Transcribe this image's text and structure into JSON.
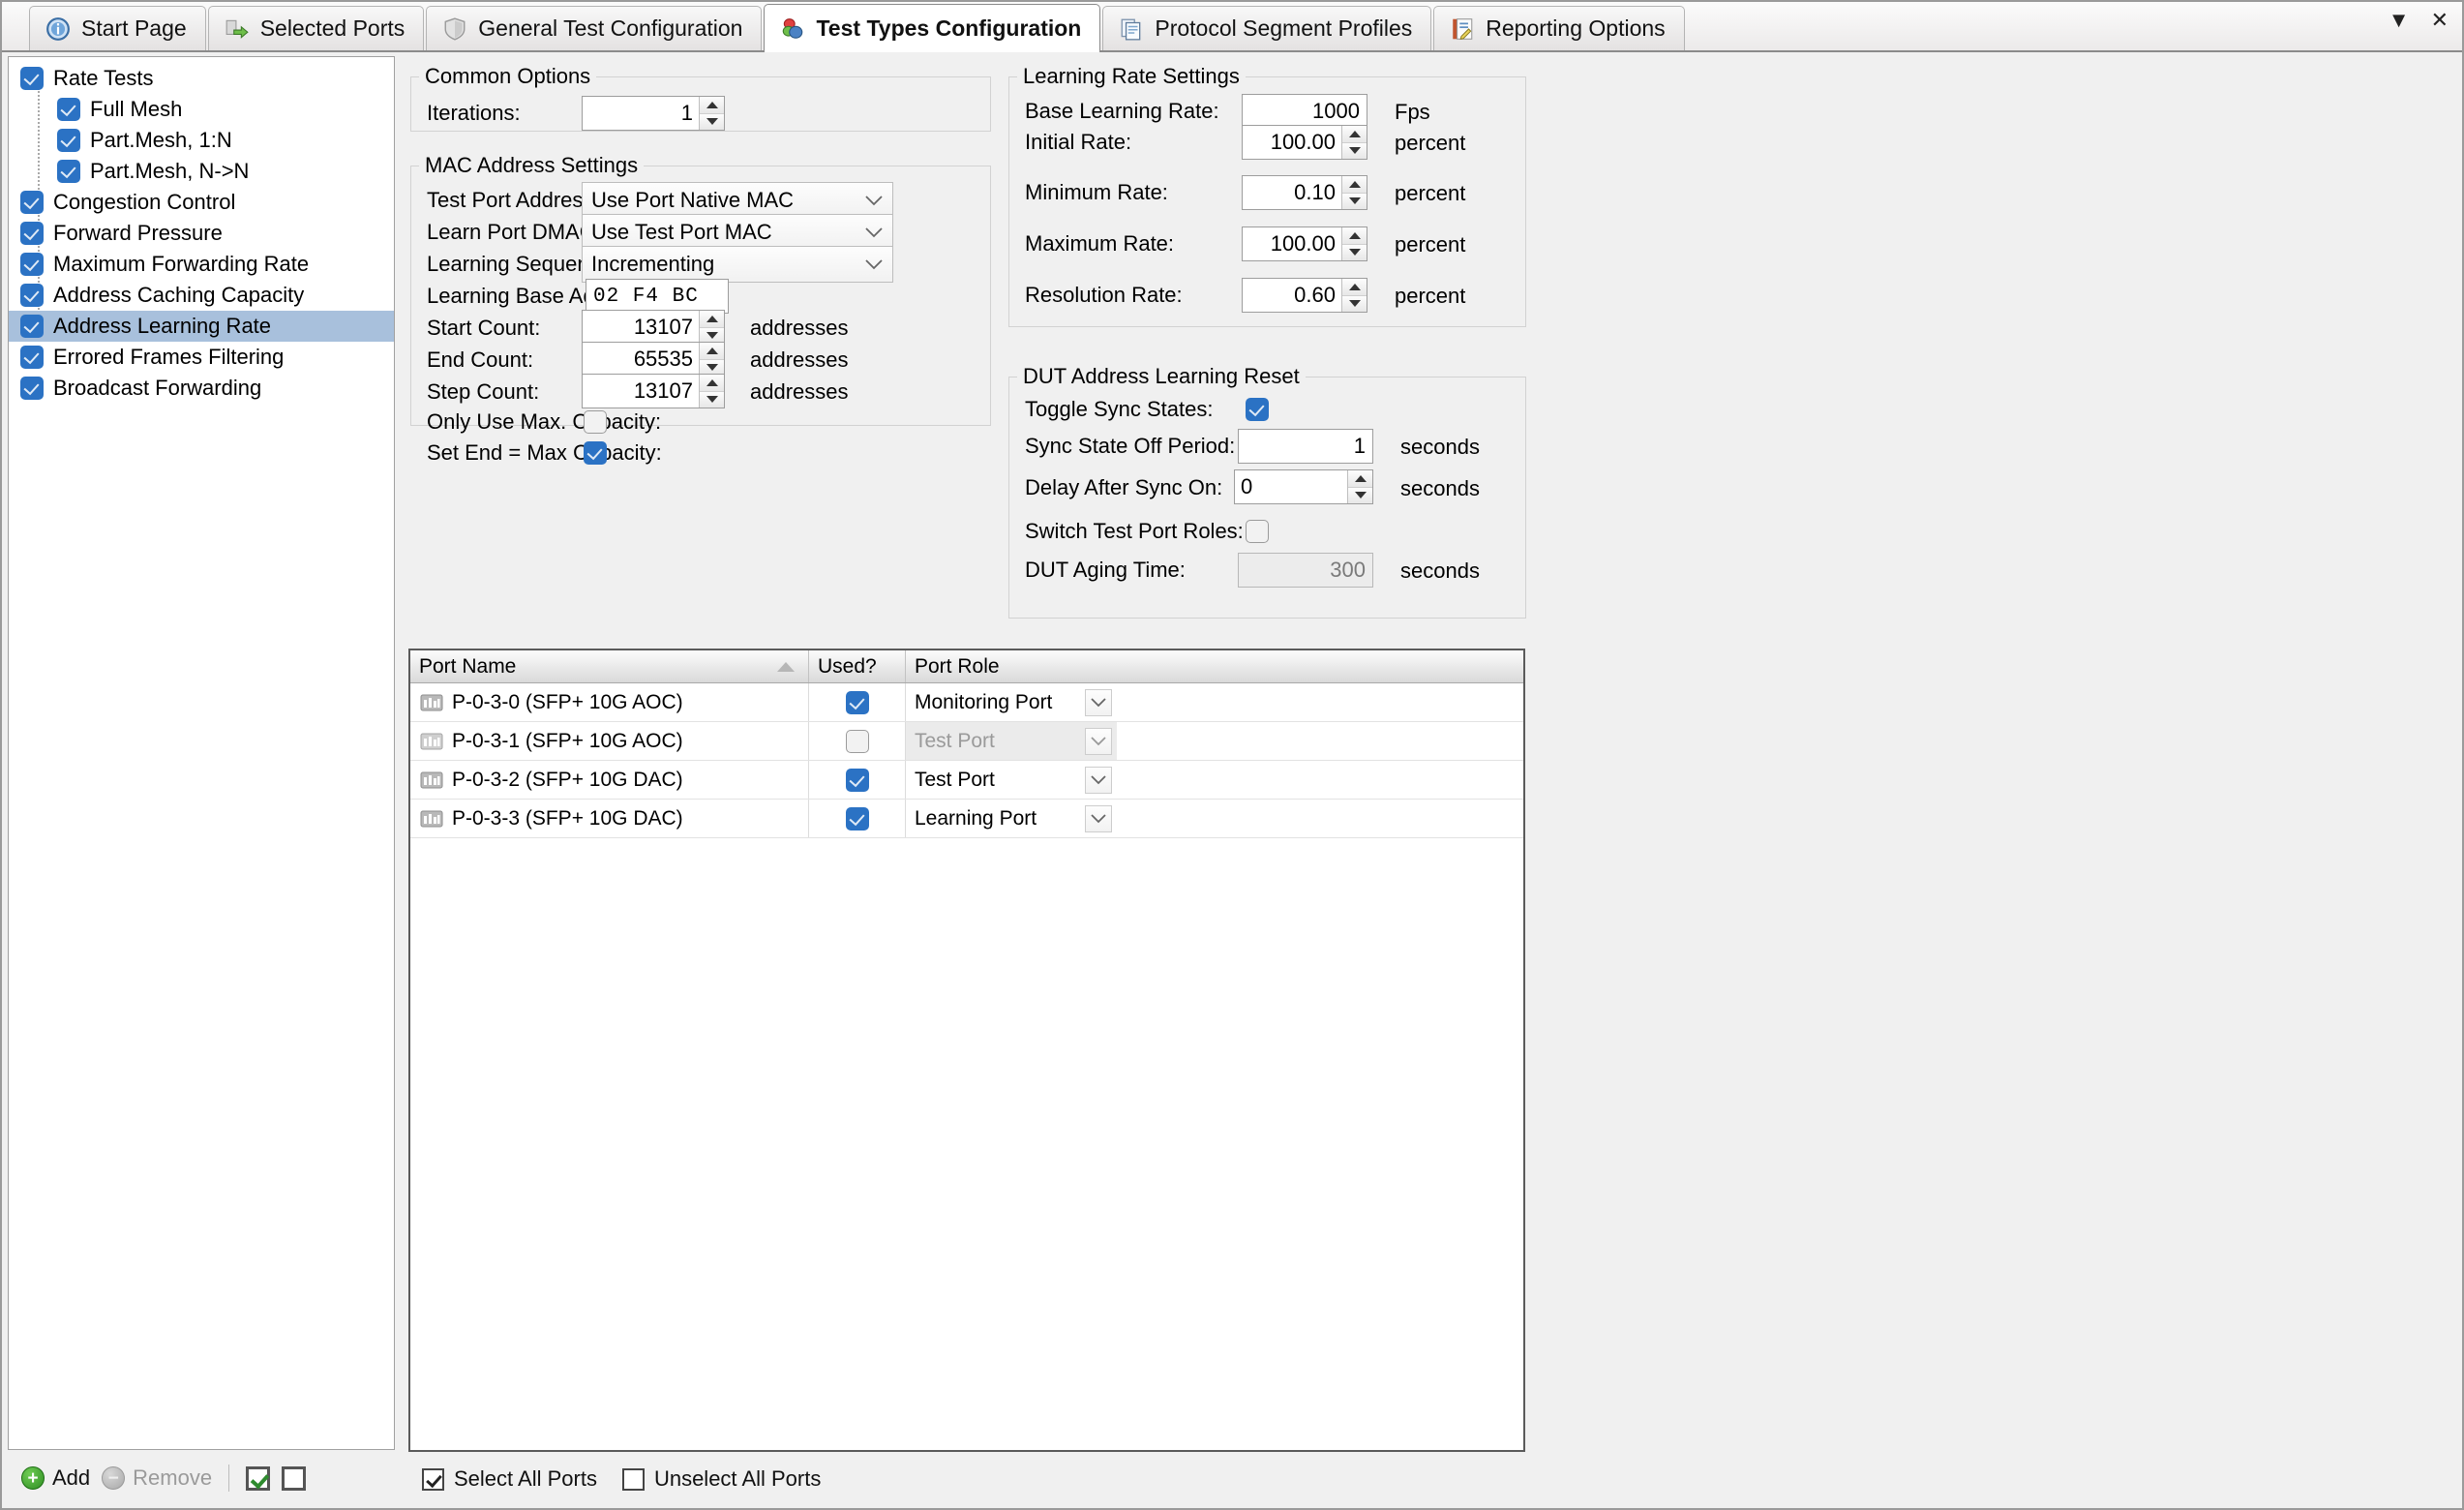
{
  "window": {
    "minimize_glyph": "▼",
    "close_glyph": "✕"
  },
  "tabs": [
    {
      "label": "Start Page",
      "icon": "info-icon",
      "active": false
    },
    {
      "label": "Selected Ports",
      "icon": "ports-icon",
      "active": false
    },
    {
      "label": "General Test Configuration",
      "icon": "shield-icon",
      "active": false
    },
    {
      "label": "Test Types Configuration",
      "icon": "test-types-icon",
      "active": true
    },
    {
      "label": "Protocol Segment Profiles",
      "icon": "documents-icon",
      "active": false
    },
    {
      "label": "Reporting Options",
      "icon": "report-icon",
      "active": false
    }
  ],
  "tree": {
    "items": [
      {
        "label": "Rate Tests",
        "checked": true,
        "child": false,
        "selected": false
      },
      {
        "label": "Full Mesh",
        "checked": true,
        "child": true,
        "selected": false
      },
      {
        "label": "Part.Mesh, 1:N",
        "checked": true,
        "child": true,
        "selected": false
      },
      {
        "label": "Part.Mesh, N->N",
        "checked": true,
        "child": true,
        "selected": false
      },
      {
        "label": "Congestion Control",
        "checked": true,
        "child": false,
        "selected": false
      },
      {
        "label": "Forward Pressure",
        "checked": true,
        "child": false,
        "selected": false
      },
      {
        "label": "Maximum Forwarding Rate",
        "checked": true,
        "child": false,
        "selected": false
      },
      {
        "label": "Address Caching Capacity",
        "checked": true,
        "child": false,
        "selected": false
      },
      {
        "label": "Address Learning Rate",
        "checked": true,
        "child": false,
        "selected": true
      },
      {
        "label": "Errored Frames Filtering",
        "checked": true,
        "child": false,
        "selected": false
      },
      {
        "label": "Broadcast Forwarding",
        "checked": true,
        "child": false,
        "selected": false
      }
    ],
    "toolbar": {
      "add_label": "Add",
      "add_glyph": "+",
      "remove_label": "Remove",
      "remove_glyph": "−",
      "check_all_checked": true,
      "uncheck_all_checked": false
    }
  },
  "common_options": {
    "title": "Common Options",
    "iterations_label": "Iterations:",
    "iterations_value": "1"
  },
  "mac_address_settings": {
    "title": "MAC Address Settings",
    "test_port_address_mode_label": "Test Port Address Mode:",
    "test_port_address_mode_value": "Use Port Native MAC",
    "learn_port_dmac_mode_label": "Learn Port DMAC Mode:",
    "learn_port_dmac_mode_value": "Use Test Port MAC",
    "learning_sequence_label": "Learning Sequence:",
    "learning_sequence_value": "Incrementing",
    "learning_base_address_label": "Learning Base Address:",
    "learning_base_address_value": "02  F4  BC",
    "start_count_label": "Start Count:",
    "start_count_value": "13107",
    "start_count_unit": "addresses",
    "end_count_label": "End Count:",
    "end_count_value": "65535",
    "end_count_unit": "addresses",
    "step_count_label": "Step Count:",
    "step_count_value": "13107",
    "step_count_unit": "addresses",
    "only_use_max_capacity_label": "Only Use Max. Capacity:",
    "only_use_max_capacity_checked": false,
    "set_end_max_capacity_label": "Set End = Max Capacity:",
    "set_end_max_capacity_checked": true
  },
  "learning_rate_settings": {
    "title": "Learning Rate Settings",
    "base_learning_rate_label": "Base Learning Rate:",
    "base_learning_rate_value": "1000",
    "base_learning_rate_unit": "Fps",
    "initial_rate_label": "Initial Rate:",
    "initial_rate_value": "100.00",
    "initial_rate_unit": "percent",
    "minimum_rate_label": "Minimum Rate:",
    "minimum_rate_value": "0.10",
    "minimum_rate_unit": "percent",
    "maximum_rate_label": "Maximum Rate:",
    "maximum_rate_value": "100.00",
    "maximum_rate_unit": "percent",
    "resolution_rate_label": "Resolution Rate:",
    "resolution_rate_value": "0.60",
    "resolution_rate_unit": "percent"
  },
  "dut_address_learning_reset": {
    "title": "DUT Address Learning Reset",
    "toggle_sync_states_label": "Toggle Sync States:",
    "toggle_sync_states_checked": true,
    "sync_state_off_period_label": "Sync State Off Period:",
    "sync_state_off_period_value": "1",
    "sync_state_off_period_unit": "seconds",
    "delay_after_sync_on_label": "Delay After Sync On:",
    "delay_after_sync_on_value": "0",
    "delay_after_sync_on_unit": "seconds",
    "switch_test_port_roles_label": "Switch Test Port Roles:",
    "switch_test_port_roles_checked": false,
    "dut_aging_time_label": "DUT Aging Time:",
    "dut_aging_time_value": "300",
    "dut_aging_time_unit": "seconds"
  },
  "port_grid": {
    "columns": [
      "Port Name",
      "Used?",
      "Port Role"
    ],
    "sorted_column": "Port Name",
    "sort_direction": "ascending",
    "rows": [
      {
        "name": "P-0-3-0 (SFP+ 10G AOC)",
        "used": true,
        "role": "Monitoring Port",
        "role_enabled": true
      },
      {
        "name": "P-0-3-1 (SFP+ 10G AOC)",
        "used": false,
        "role": "Test Port",
        "role_enabled": false
      },
      {
        "name": "P-0-3-2 (SFP+ 10G DAC)",
        "used": true,
        "role": "Test Port",
        "role_enabled": true
      },
      {
        "name": "P-0-3-3 (SFP+ 10G DAC)",
        "used": true,
        "role": "Learning Port",
        "role_enabled": true
      }
    ]
  },
  "port_footer": {
    "select_all_label": "Select All Ports",
    "select_all_checked": true,
    "unselect_all_label": "Unselect All Ports",
    "unselect_all_checked": false
  }
}
